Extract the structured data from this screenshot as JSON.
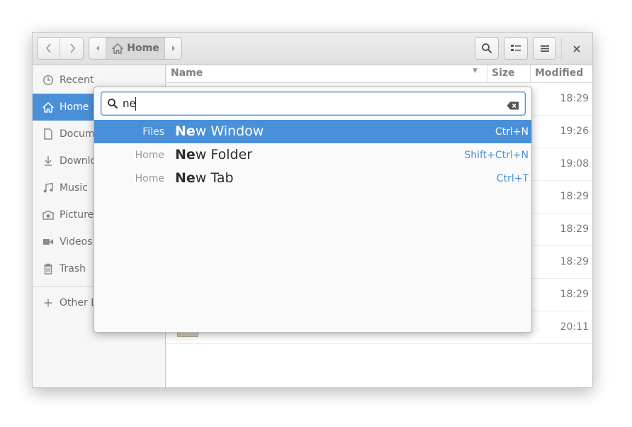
{
  "header": {
    "path_home_label": "Home",
    "back_icon": "chevron-left-icon",
    "forward_icon": "chevron-right-icon"
  },
  "sidebar": {
    "items": [
      {
        "label": "Recent",
        "icon": "clock-icon"
      },
      {
        "label": "Home",
        "icon": "home-icon"
      },
      {
        "label": "Docume",
        "icon": "document-icon"
      },
      {
        "label": "Downlo",
        "icon": "download-icon"
      },
      {
        "label": "Music",
        "icon": "music-icon"
      },
      {
        "label": "Pictures",
        "icon": "camera-icon"
      },
      {
        "label": "Videos",
        "icon": "video-icon"
      },
      {
        "label": "Trash",
        "icon": "trash-icon"
      },
      {
        "label": "Other L",
        "icon": "plus-icon"
      }
    ]
  },
  "list": {
    "columns": {
      "name": "Name",
      "size": "Size",
      "modified": "Modified"
    },
    "times": [
      "18:29",
      "19:26",
      "19:08",
      "18:29",
      "18:29",
      "18:29",
      "18:29",
      "20:11"
    ]
  },
  "command": {
    "query": "ne",
    "results": [
      {
        "scope": "Files",
        "match": "Ne",
        "rest": "w Window",
        "accel": "Ctrl+N"
      },
      {
        "scope": "Home",
        "match": "Ne",
        "rest": "w Folder",
        "accel": "Shift+Ctrl+N"
      },
      {
        "scope": "Home",
        "match": "Ne",
        "rest": "w Tab",
        "accel": "Ctrl+T"
      }
    ]
  },
  "colors": {
    "accent": "#4a90d9"
  }
}
